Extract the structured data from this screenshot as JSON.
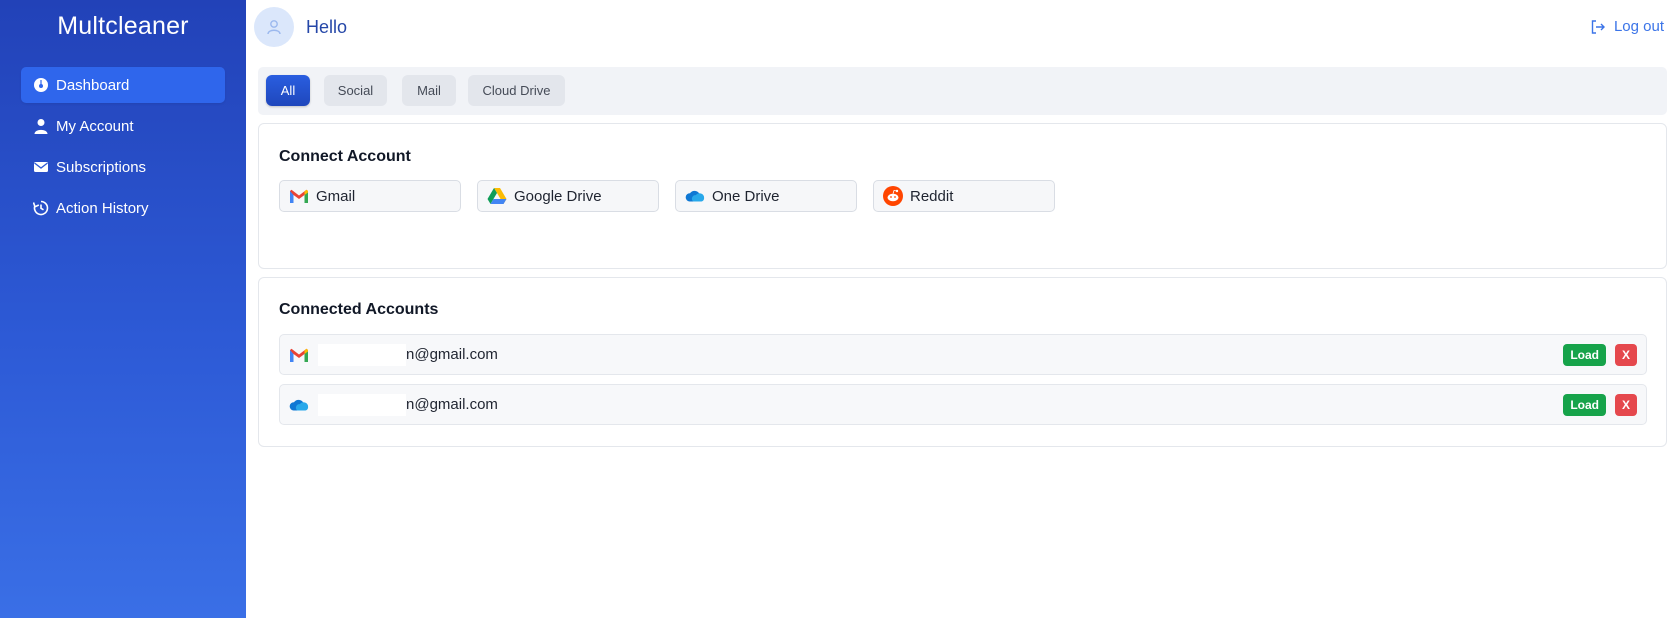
{
  "app": {
    "brand": "Multcleaner"
  },
  "sidebar": {
    "items": [
      {
        "label": "Dashboard",
        "icon": "dashboard-gauge-icon",
        "active": true
      },
      {
        "label": "My Account",
        "icon": "user-icon",
        "active": false
      },
      {
        "label": "Subscriptions",
        "icon": "envelope-icon",
        "active": false
      },
      {
        "label": "Action History",
        "icon": "history-icon",
        "active": false
      }
    ]
  },
  "header": {
    "greeting": "Hello",
    "logout_label": "Log out"
  },
  "filters": {
    "tabs": [
      {
        "label": "All",
        "active": true
      },
      {
        "label": "Social",
        "active": false
      },
      {
        "label": "Mail",
        "active": false
      },
      {
        "label": "Cloud Drive",
        "active": false
      }
    ]
  },
  "connect": {
    "title": "Connect Account",
    "services": [
      {
        "label": "Gmail",
        "icon": "gmail-icon"
      },
      {
        "label": "Google Drive",
        "icon": "google-drive-icon"
      },
      {
        "label": "One Drive",
        "icon": "onedrive-icon"
      },
      {
        "label": "Reddit",
        "icon": "reddit-icon"
      }
    ]
  },
  "connected": {
    "title": "Connected Accounts",
    "accounts": [
      {
        "service_icon": "gmail-icon",
        "email": "n@gmail.com",
        "load_label": "Load",
        "remove_label": "X"
      },
      {
        "service_icon": "onedrive-icon",
        "email": "n@gmail.com",
        "load_label": "Load",
        "remove_label": "X"
      }
    ]
  },
  "colors": {
    "sidebar_top": "#2242b8",
    "sidebar_bottom": "#3a6fe6",
    "accent": "#2f66ec",
    "load": "#16a34a",
    "remove": "#e5484d"
  }
}
